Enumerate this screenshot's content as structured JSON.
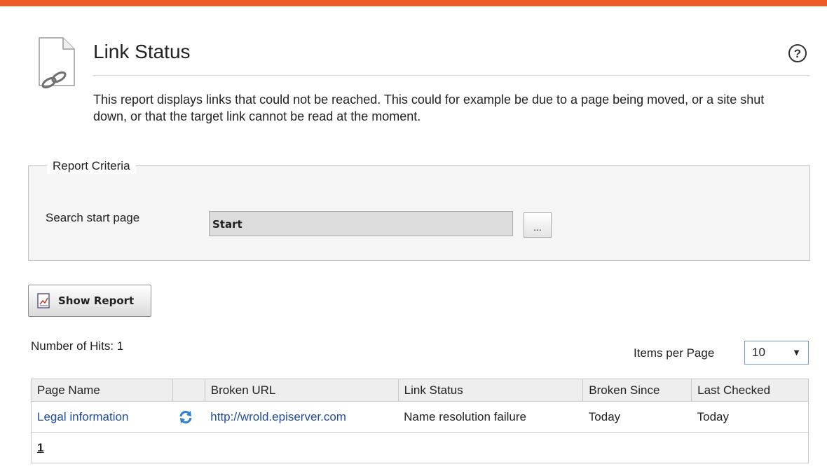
{
  "header": {
    "title": "Link Status",
    "help_icon": "help-icon",
    "page_icon": "document-link-icon",
    "accent_color": "#f05a28"
  },
  "description": "This report displays links that could not be reached. This could for example be due to a page being moved, or a site shut down, or that the target link cannot be read at the moment.",
  "criteria": {
    "legend": "Report Criteria",
    "search_start_label": "Search start page",
    "search_start_value": "Start",
    "browse_label": "..."
  },
  "actions": {
    "show_report_label": "Show Report",
    "show_report_icon": "report-icon"
  },
  "results": {
    "hits_label": "Number of Hits: 1",
    "items_per_page_label": "Items per Page",
    "items_per_page_value": "10",
    "columns": [
      "Page Name",
      "",
      "Broken URL",
      "Link Status",
      "Broken Since",
      "Last Checked"
    ],
    "rows": [
      {
        "page_name": "Legal information",
        "recheck_icon": "refresh-icon",
        "broken_url": "http://wrold.episerver.com",
        "link_status": "Name resolution failure",
        "broken_since": "Today",
        "last_checked": "Today"
      }
    ],
    "pager": {
      "current_page": "1"
    }
  },
  "colors": {
    "link": "#1e4c9a",
    "header_bg": "#eeeeee",
    "panel_bg": "#f5f5f5"
  }
}
